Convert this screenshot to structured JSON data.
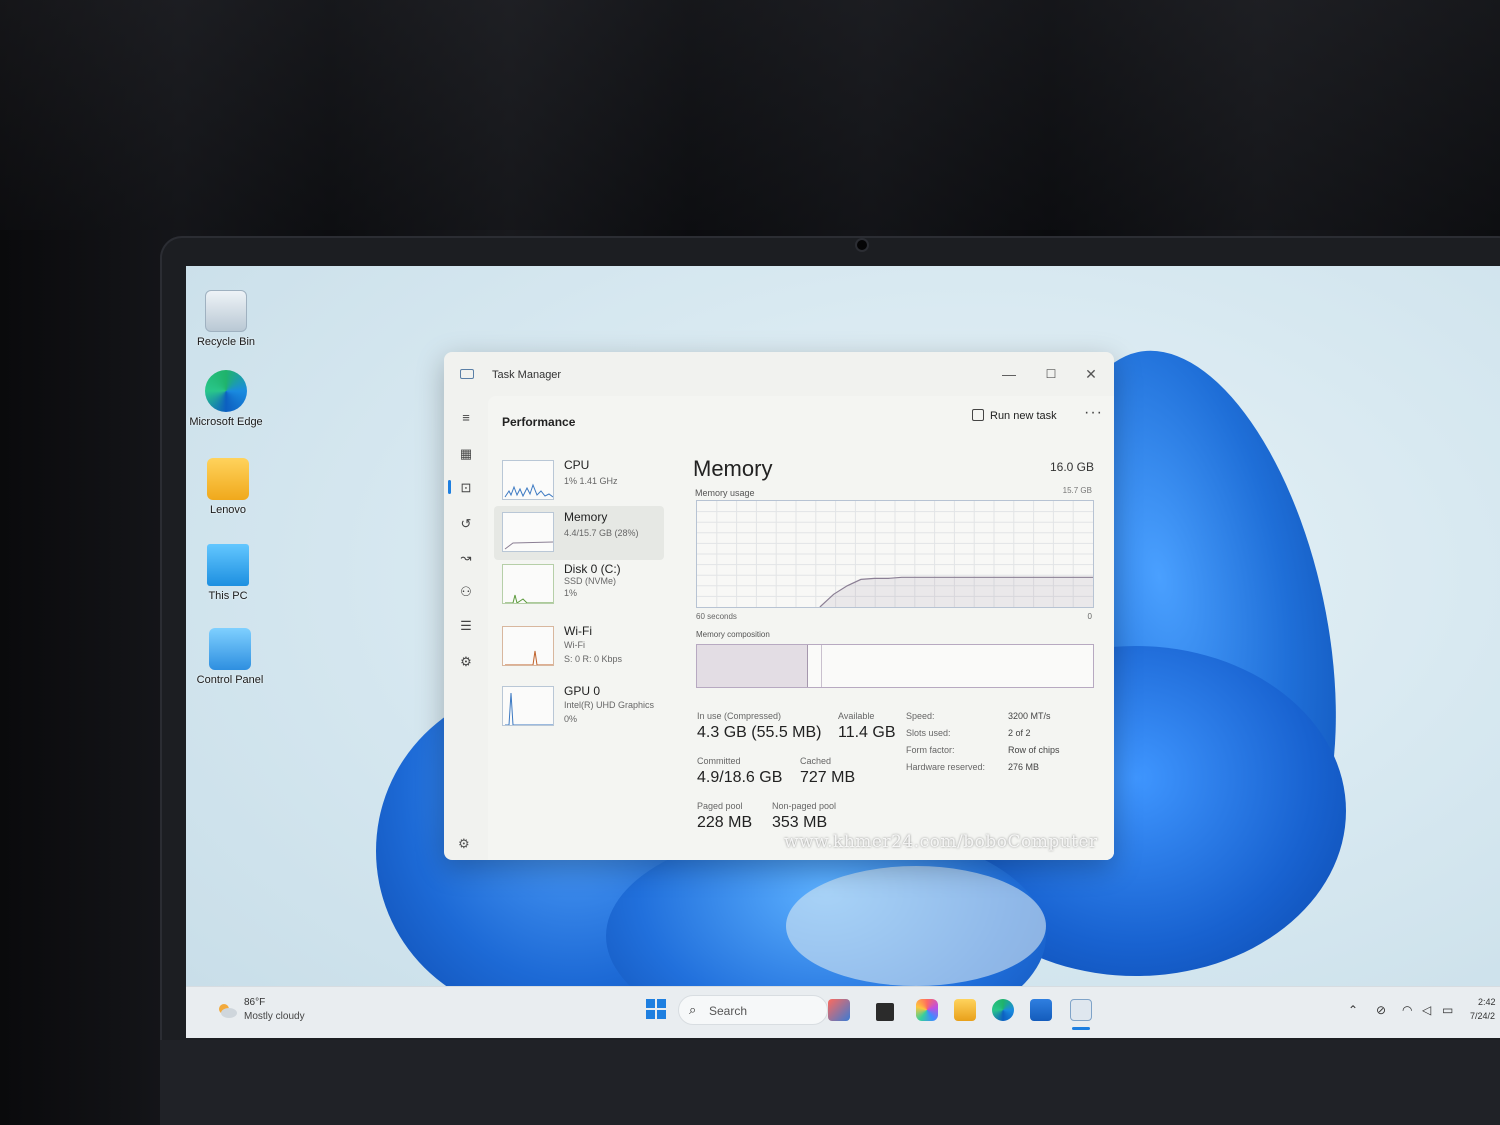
{
  "desktop": {
    "icons": [
      {
        "label": "Recycle Bin"
      },
      {
        "label": "Microsoft Edge"
      },
      {
        "label": "Lenovo"
      },
      {
        "label": "This PC"
      },
      {
        "label": "Control Panel"
      }
    ]
  },
  "window": {
    "title": "Task Manager",
    "minimize": "—",
    "maximize": "☐",
    "close": "✕"
  },
  "toolbar": {
    "page_title": "Performance",
    "run_new_task": "Run new task",
    "more": "···"
  },
  "resources": [
    {
      "name": "CPU",
      "line1": "1% 1.41 GHz",
      "line2": ""
    },
    {
      "name": "Memory",
      "line1": "4.4/15.7 GB (28%)",
      "line2": ""
    },
    {
      "name": "Disk 0 (C:)",
      "line1": "SSD (NVMe)",
      "line2": "1%"
    },
    {
      "name": "Wi-Fi",
      "line1": "Wi-Fi",
      "line2": "S: 0 R: 0 Kbps"
    },
    {
      "name": "GPU 0",
      "line1": "Intel(R) UHD Graphics",
      "line2": "0%"
    }
  ],
  "memory": {
    "title": "Memory",
    "total": "16.0 GB",
    "usage_label": "Memory usage",
    "usage_max": "15.7 GB",
    "graph_x_left": "60 seconds",
    "graph_x_right": "0",
    "composition_label": "Memory composition",
    "composition_in_use_fraction": 0.28,
    "usage_history_fraction": [
      0,
      0,
      0,
      0,
      0,
      0,
      0,
      0,
      0,
      0,
      0.12,
      0.2,
      0.26,
      0.27,
      0.27,
      0.28,
      0.28,
      0.28,
      0.28,
      0.28,
      0.28,
      0.28,
      0.28,
      0.28,
      0.28,
      0.28,
      0.28,
      0.28,
      0.28,
      0.28
    ],
    "stats": {
      "in_use_label": "In use (Compressed)",
      "in_use_value": "4.3 GB (55.5 MB)",
      "available_label": "Available",
      "available_value": "11.4 GB",
      "committed_label": "Committed",
      "committed_value": "4.9/18.6 GB",
      "cached_label": "Cached",
      "cached_value": "727 MB",
      "paged_pool_label": "Paged pool",
      "paged_pool_value": "228 MB",
      "non_paged_pool_label": "Non-paged pool",
      "non_paged_pool_value": "353 MB"
    },
    "details": {
      "speed_label": "Speed:",
      "speed_value": "3200 MT/s",
      "slots_label": "Slots used:",
      "slots_value": "2 of 2",
      "form_factor_label": "Form factor:",
      "form_factor_value": "Row of chips",
      "hw_reserved_label": "Hardware reserved:",
      "hw_reserved_value": "276 MB"
    }
  },
  "watermark": "www.khmer24.com/boboComputer",
  "taskbar": {
    "weather_temp": "86°F",
    "weather_desc": "Mostly cloudy",
    "search_placeholder": "Search",
    "clock_time": "2:42",
    "clock_date": "7/24/2"
  },
  "colors": {
    "accent": "#1e7fe0",
    "memory_graph": "#8b7f94",
    "wallpaper_bloom": "#1f6fd8"
  }
}
